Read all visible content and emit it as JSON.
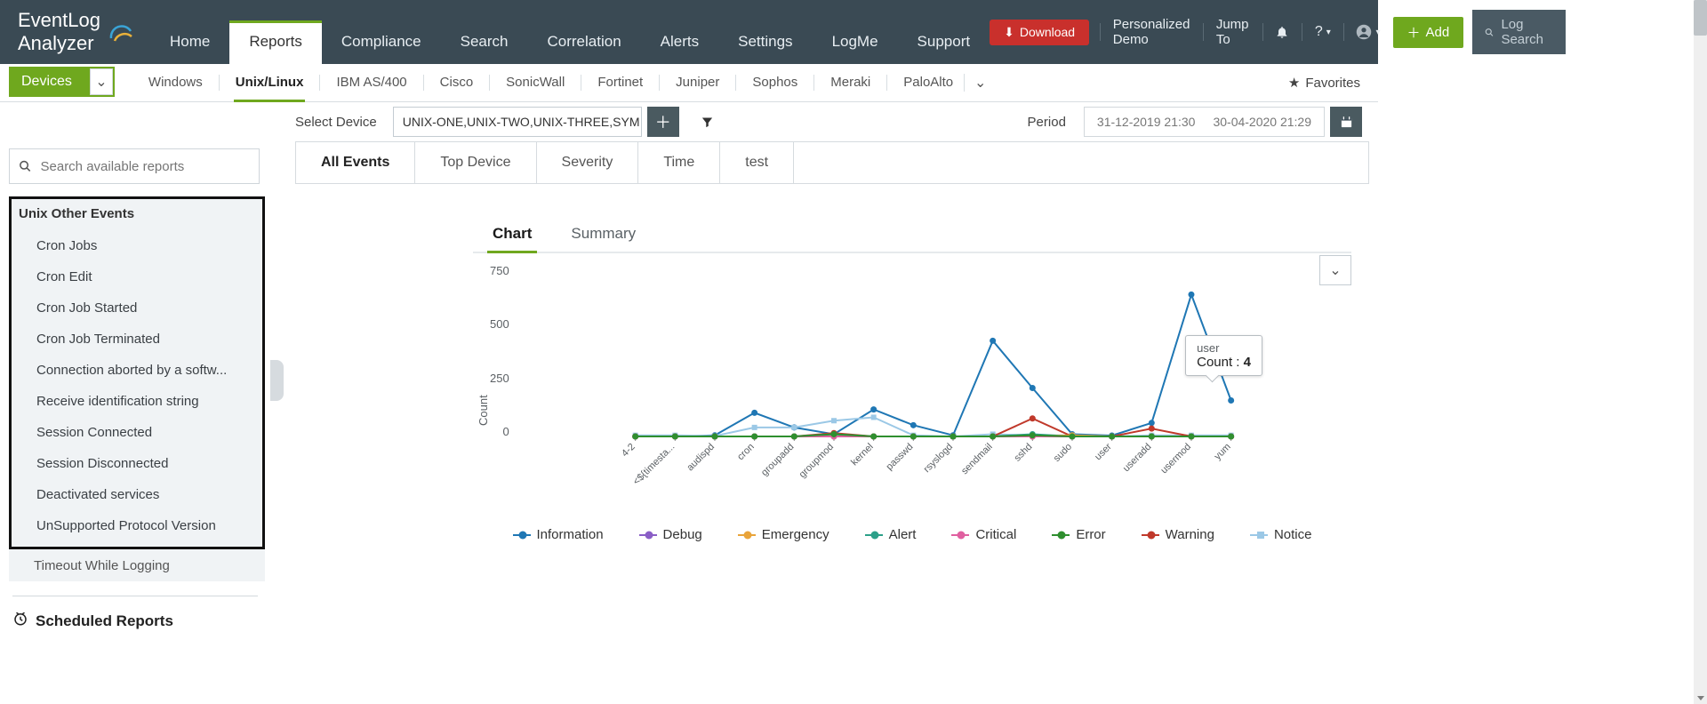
{
  "brand": "EventLog Analyzer",
  "top_right": {
    "download": "Download",
    "demo": "Personalized Demo",
    "jump": "Jump To"
  },
  "nav": {
    "home": "Home",
    "reports": "Reports",
    "compliance": "Compliance",
    "search": "Search",
    "correlation": "Correlation",
    "alerts": "Alerts",
    "settings": "Settings",
    "logme": "LogMe",
    "support": "Support",
    "add": "Add",
    "log_search": "Log Search"
  },
  "subtabs": {
    "devices": "Devices",
    "windows": "Windows",
    "unix": "Unix/Linux",
    "ibm": "IBM AS/400",
    "cisco": "Cisco",
    "sonicwall": "SonicWall",
    "fortinet": "Fortinet",
    "juniper": "Juniper",
    "sophos": "Sophos",
    "meraki": "Meraki",
    "paloalto": "PaloAlto",
    "favorites": "Favorites"
  },
  "filter": {
    "select_device": "Select Device",
    "device_value": "UNIX-ONE,UNIX-TWO,UNIX-THREE,SYM",
    "period": "Period",
    "from": "31-12-2019 21:30",
    "to": "30-04-2020 21:29"
  },
  "search_placeholder": "Search available reports",
  "tree": {
    "title": "Unix Other Events",
    "items": [
      "Cron Jobs",
      "Cron Edit",
      "Cron Job Started",
      "Cron Job Terminated",
      "Connection aborted by a softw...",
      "Receive identification string",
      "Session Connected",
      "Session Disconnected",
      "Deactivated services",
      "UnSupported Protocol Version"
    ],
    "truncated": "Timeout While Logging"
  },
  "scheduled": "Scheduled Reports",
  "event_tabs": {
    "all": "All Events",
    "top": "Top Device",
    "sev": "Severity",
    "time": "Time",
    "test": "test"
  },
  "chart_tabs": {
    "chart": "Chart",
    "summary": "Summary"
  },
  "tooltip": {
    "line1": "user",
    "label": "Count :",
    "value": "4"
  },
  "legend": {
    "information": "Information",
    "debug": "Debug",
    "emergency": "Emergency",
    "alert": "Alert",
    "critical": "Critical",
    "error": "Error",
    "warning": "Warning",
    "notice": "Notice"
  },
  "colors": {
    "information": "#1f77b4",
    "debug": "#8a5ec6",
    "emergency": "#e9a43a",
    "alert": "#2ca089",
    "critical": "#e060a0",
    "error": "#2f8f2f",
    "warning": "#c0392b",
    "notice": "#9bc8e6",
    "axis": "#888"
  },
  "chart_data": {
    "type": "line",
    "ylabel": "Count",
    "ylim": [
      0,
      750
    ],
    "ticks": [
      0,
      250,
      500,
      750
    ],
    "categories": [
      "4-2",
      "<${timesta...",
      "audispd",
      "cron",
      "groupadd",
      "groupmod",
      "kernel",
      "passwd",
      "rsyslogd",
      "sendmail",
      "sshd",
      "sudo",
      "user",
      "useradd",
      "usermod",
      "yum"
    ],
    "series": [
      {
        "name": "Information",
        "color": "#1f77b4",
        "values": [
          0,
          0,
          5,
          105,
          40,
          10,
          120,
          50,
          5,
          425,
          215,
          10,
          4,
          60,
          630,
          160
        ]
      },
      {
        "name": "Notice",
        "color": "#9bc8e6",
        "values": [
          5,
          5,
          2,
          40,
          40,
          70,
          85,
          5,
          0,
          10,
          5,
          5,
          0,
          5,
          5,
          5
        ]
      },
      {
        "name": "Warning",
        "color": "#c0392b",
        "values": [
          0,
          0,
          0,
          0,
          0,
          15,
          0,
          0,
          0,
          0,
          80,
          0,
          0,
          35,
          0,
          0
        ]
      },
      {
        "name": "Alert",
        "color": "#2ca089",
        "values": [
          0,
          0,
          0,
          0,
          0,
          10,
          0,
          0,
          0,
          0,
          10,
          0,
          0,
          0,
          0,
          0
        ]
      },
      {
        "name": "Debug",
        "color": "#8a5ec6",
        "values": [
          0,
          0,
          0,
          0,
          0,
          0,
          0,
          0,
          0,
          0,
          0,
          0,
          0,
          0,
          0,
          0
        ]
      },
      {
        "name": "Emergency",
        "color": "#e9a43a",
        "values": [
          0,
          0,
          0,
          0,
          0,
          0,
          0,
          0,
          0,
          0,
          0,
          5,
          0,
          0,
          0,
          0
        ]
      },
      {
        "name": "Critical",
        "color": "#e060a0",
        "values": [
          0,
          0,
          0,
          0,
          0,
          0,
          0,
          0,
          0,
          0,
          0,
          0,
          0,
          0,
          0,
          0
        ]
      },
      {
        "name": "Error",
        "color": "#2f8f2f",
        "values": [
          0,
          0,
          0,
          0,
          0,
          10,
          0,
          0,
          0,
          0,
          5,
          0,
          0,
          0,
          0,
          0
        ]
      }
    ]
  }
}
